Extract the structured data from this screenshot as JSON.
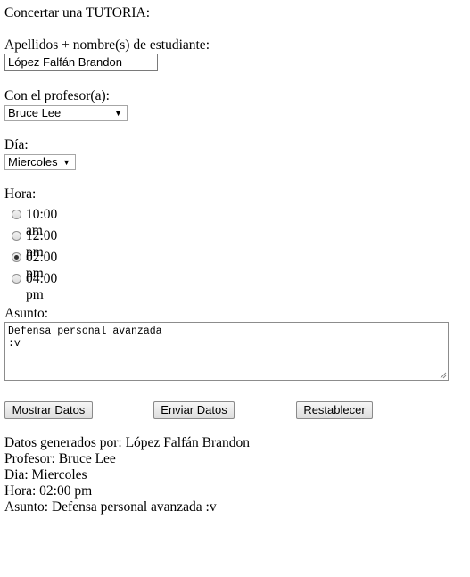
{
  "form": {
    "title": "Concertar una TUTORIA:",
    "student_label": "Apellidos + nombre(s) de estudiante:",
    "student_value": "López Falfán Brandon",
    "teacher_label": "Con el profesor(a):",
    "teacher_selected": "Bruce Lee",
    "day_label": "Día:",
    "day_selected": "Miercoles",
    "time_label": "Hora:",
    "time_options": [
      {
        "label": "10:00 am",
        "checked": false
      },
      {
        "label": "12:00 pm",
        "checked": false
      },
      {
        "label": "02:00 pm",
        "checked": true
      },
      {
        "label": "04:00 pm",
        "checked": false
      }
    ],
    "subject_label": "Asunto:",
    "subject_line1": "Defensa personal avanzada",
    "subject_line2": ":v"
  },
  "buttons": {
    "show": "Mostrar Datos",
    "send": "Enviar Datos",
    "reset": "Restablecer"
  },
  "output": {
    "generated_by": "Datos generados por: López Falfán Brandon",
    "teacher": "Profesor: Bruce Lee",
    "day": "Dia: Miercoles",
    "time": "Hora: 02:00 pm",
    "subject": "Asunto: Defensa personal avanzada :v"
  }
}
